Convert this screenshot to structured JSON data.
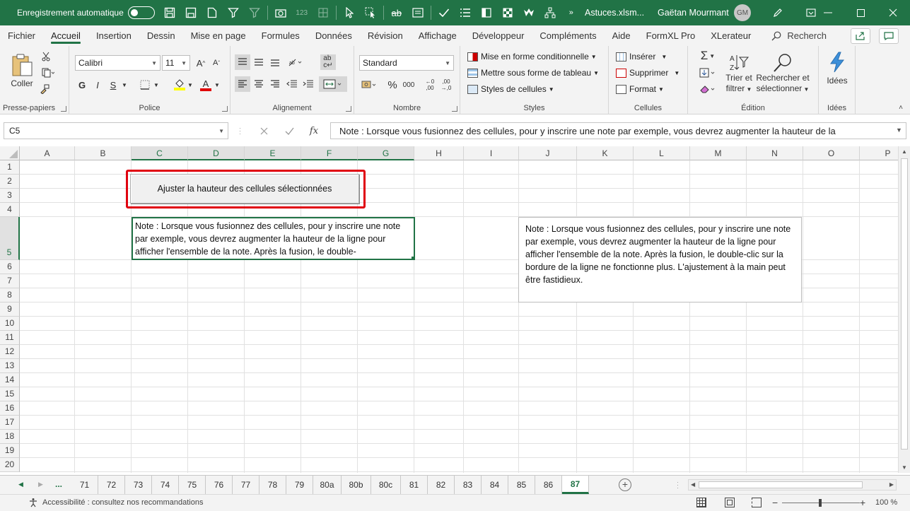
{
  "titlebar": {
    "autosave_label": "Enregistrement automatique",
    "filename": "Astuces.xlsm...",
    "user_name": "Gaëtan Mourmant",
    "user_initials": "GM"
  },
  "menu": {
    "tabs": [
      "Fichier",
      "Accueil",
      "Insertion",
      "Dessin",
      "Mise en page",
      "Formules",
      "Données",
      "Révision",
      "Affichage",
      "Développeur",
      "Compléments",
      "Aide",
      "FormXL Pro",
      "XLerateur"
    ],
    "active_tab": "Accueil",
    "search_placeholder": "Recherch"
  },
  "ribbon": {
    "clipboard": {
      "label": "Presse-papiers",
      "paste": "Coller"
    },
    "font": {
      "label": "Police",
      "font_name": "Calibri",
      "font_size": "11",
      "bold": "G",
      "italic": "I",
      "underline": "S"
    },
    "alignment": {
      "label": "Alignement"
    },
    "number": {
      "label": "Nombre",
      "format": "Standard"
    },
    "styles": {
      "label": "Styles",
      "cond_format": "Mise en forme conditionnelle",
      "table_format": "Mettre sous forme de tableau",
      "cell_styles": "Styles de cellules"
    },
    "cells": {
      "label": "Cellules",
      "insert": "Insérer",
      "delete": "Supprimer",
      "format": "Format"
    },
    "editing": {
      "label": "Édition",
      "sort_1": "Trier et",
      "sort_2": "filtrer",
      "find_1": "Rechercher et",
      "find_2": "sélectionner"
    },
    "ideas": {
      "label": "Idées",
      "button": "Idées"
    }
  },
  "formula_bar": {
    "name_box": "C5",
    "fx": "fx",
    "content": "Note : Lorsque vous fusionnez des cellules, pour y inscrire une note par exemple, vous devrez augmenter la hauteur de la"
  },
  "grid": {
    "columns": [
      "A",
      "B",
      "C",
      "D",
      "E",
      "F",
      "G",
      "H",
      "I",
      "J",
      "K",
      "L",
      "M",
      "N",
      "O",
      "P"
    ],
    "rows": [
      "1",
      "2",
      "3",
      "4",
      "5",
      "6",
      "7",
      "8",
      "9",
      "10",
      "11",
      "12",
      "13",
      "14",
      "15",
      "16",
      "17",
      "18",
      "19",
      "20"
    ],
    "selected_columns": [
      "C",
      "D",
      "E",
      "F",
      "G"
    ],
    "selected_row": "5"
  },
  "sheet": {
    "macro_button_label": "Ajuster la hauteur des cellules sélectionnées",
    "cell_c5_text": "Note : Lorsque vous fusionnez des cellules, pour y inscrire une note par exemple, vous devrez augmenter la hauteur de la ligne pour afficher l'ensemble de la note. Après la fusion, le double-",
    "textbox_text": "Note : Lorsque vous fusionnez des cellules, pour y inscrire une note par exemple, vous devrez augmenter la hauteur de la ligne pour afficher l'ensemble de la note. Après la fusion, le double-clic sur la bordure de la ligne ne fonctionne plus. L'ajustement à la main peut être fastidieux."
  },
  "sheet_tabs": {
    "ellipsis": "...",
    "tabs": [
      "71",
      "72",
      "73",
      "74",
      "75",
      "76",
      "77",
      "78",
      "79",
      "80a",
      "80b",
      "80c",
      "81",
      "82",
      "83",
      "84",
      "85",
      "86",
      "87"
    ],
    "active": "87"
  },
  "status": {
    "accessibility": "Accessibilité : consultez nos recommandations",
    "zoom": "100 %"
  },
  "colors": {
    "accent": "#217346",
    "highlight_box": "#e0000f"
  }
}
